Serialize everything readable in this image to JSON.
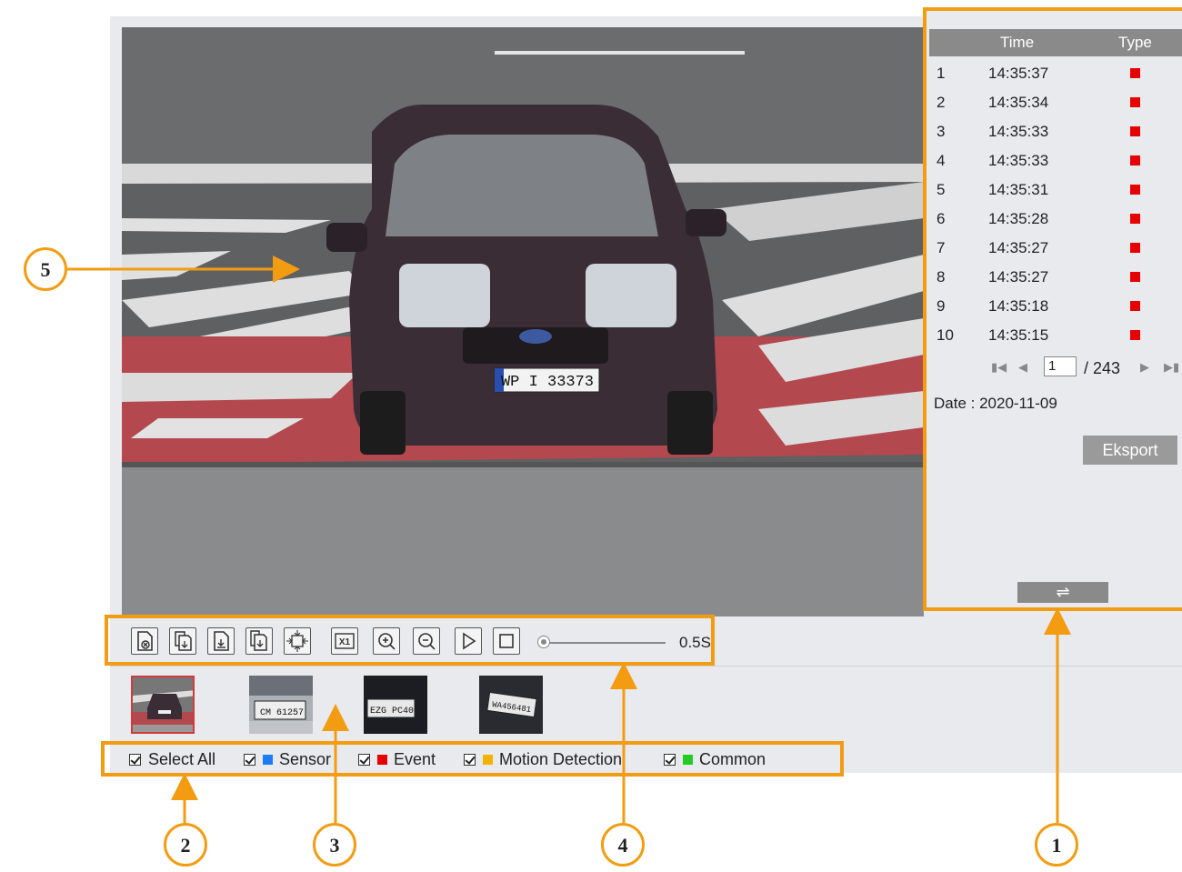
{
  "results_table": {
    "headers": {
      "time": "Time",
      "type": "Type"
    },
    "rows": [
      {
        "index": "1",
        "time": "14:35:37",
        "type_color": "#e60000"
      },
      {
        "index": "2",
        "time": "14:35:34",
        "type_color": "#e60000"
      },
      {
        "index": "3",
        "time": "14:35:33",
        "type_color": "#e60000"
      },
      {
        "index": "4",
        "time": "14:35:33",
        "type_color": "#e60000"
      },
      {
        "index": "5",
        "time": "14:35:31",
        "type_color": "#e60000"
      },
      {
        "index": "6",
        "time": "14:35:28",
        "type_color": "#e60000"
      },
      {
        "index": "7",
        "time": "14:35:27",
        "type_color": "#e60000"
      },
      {
        "index": "8",
        "time": "14:35:27",
        "type_color": "#e60000"
      },
      {
        "index": "9",
        "time": "14:35:18",
        "type_color": "#e60000"
      },
      {
        "index": "10",
        "time": "14:35:15",
        "type_color": "#e60000"
      }
    ]
  },
  "pager": {
    "current_page": "1",
    "total": "/ 243"
  },
  "date_label": "Date : 2020-11-09",
  "export_button": "Eksport",
  "swap_button": "⇌",
  "toolbar": {
    "buttons": [
      "close-file-icon",
      "copy-file-icon",
      "download-file-icon",
      "download-all-icon",
      "fit-to-window-icon",
      "original-size-icon",
      "zoom-in-icon",
      "zoom-out-icon",
      "play-icon",
      "stop-icon"
    ],
    "original_size_label": "X1",
    "speed": "0.5S"
  },
  "plates": [
    "CM 61257",
    "EZG PC40",
    "WA456481"
  ],
  "video_plate": "WP I 33373",
  "filters": {
    "select_all": "Select All",
    "sensor": {
      "label": "Sensor",
      "color": "#1e7cf2"
    },
    "event": {
      "label": "Event",
      "color": "#e60000"
    },
    "motion": {
      "label": "Motion Detection",
      "color": "#f0b400"
    },
    "common": {
      "label": "Common",
      "color": "#22cc22"
    }
  },
  "callouts": [
    "1",
    "2",
    "3",
    "4",
    "5"
  ],
  "colors": {
    "accent": "#f39c12",
    "panel": "#e8eaee",
    "header": "#8a8a8a"
  }
}
